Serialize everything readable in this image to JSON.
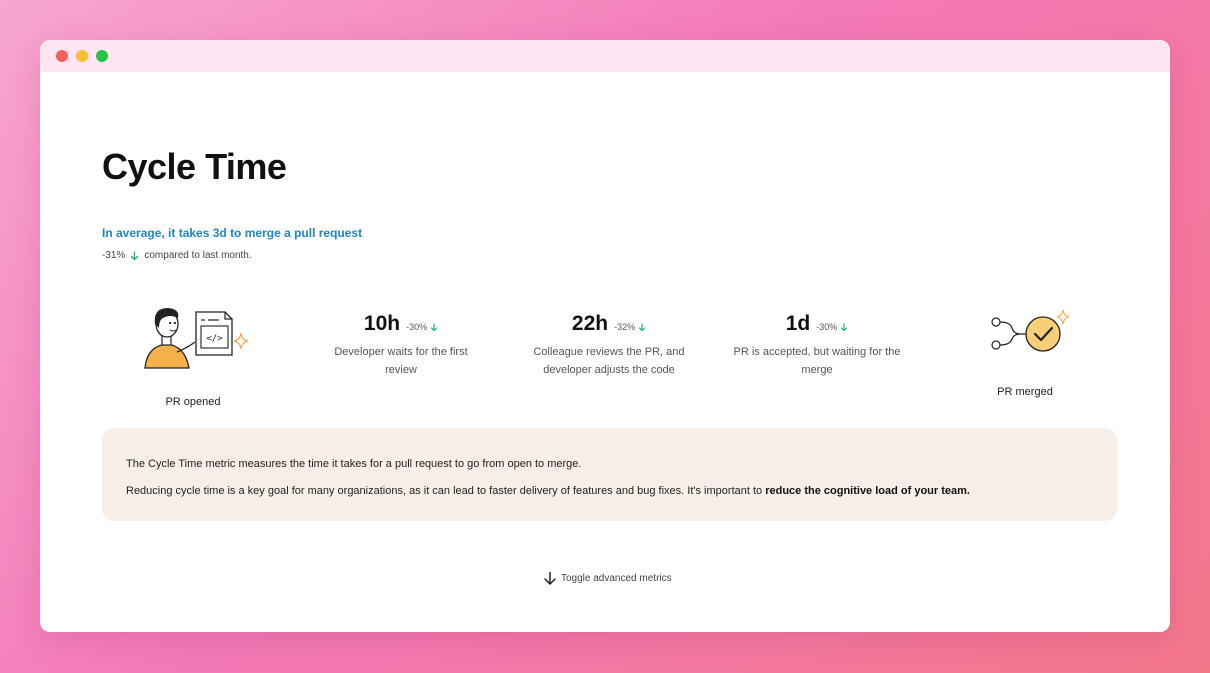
{
  "page": {
    "title": "Cycle Time",
    "headline": "In average, it takes 3d to merge a pull request",
    "change_value": "-31%",
    "change_text": "compared to last month."
  },
  "steps": {
    "start": {
      "label": "PR opened",
      "icon": "developer-pr-illustration"
    },
    "end": {
      "label": "PR merged",
      "icon": "merge-check-icon"
    }
  },
  "metrics": [
    {
      "value": "10h",
      "change": "-30%",
      "description_line1": "Developer waits for the first",
      "description_line2": "review"
    },
    {
      "value": "22h",
      "change": "-32%",
      "description_line1": "Colleague reviews the PR, and",
      "description_line2": "developer adjusts the code"
    },
    {
      "value": "1d",
      "change": "-30%",
      "description_line1": "PR is accepted, but waiting for the",
      "description_line2": "merge"
    }
  ],
  "info": {
    "paragraph1": "The Cycle Time metric measures the time it takes for a pull request to go from open to merge.",
    "paragraph2_text": "Reducing cycle time is a key goal for many organizations, as it can lead to faster delivery of features and bug fixes. It's important to ",
    "paragraph2_bold": "reduce the cognitive load of your team."
  },
  "toggle": {
    "label": "Toggle advanced metrics",
    "icon": "arrow-down-icon"
  },
  "colors": {
    "accent": "#1d86c6",
    "positive": "#22b36b",
    "info_bg": "#f7efe7",
    "sparkle": "#f5a94d"
  }
}
